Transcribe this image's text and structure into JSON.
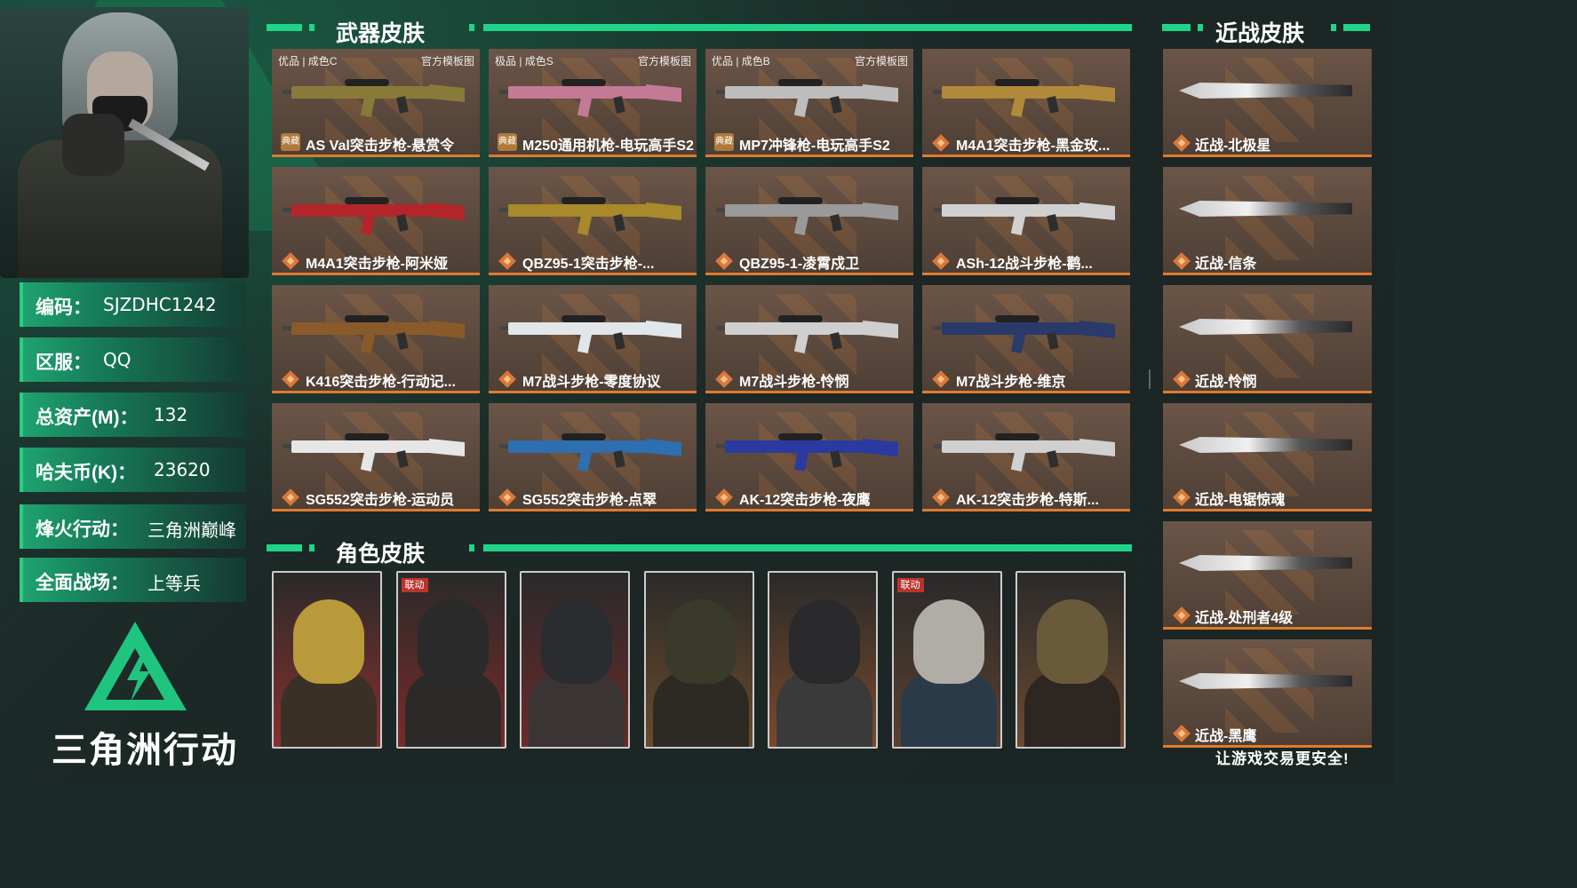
{
  "sections": {
    "weapon_skins": "武器皮肤",
    "melee_skins": "近战皮肤",
    "character_skins": "角色皮肤"
  },
  "profile": {
    "fields": [
      {
        "key": "编码",
        "value": "SJZDHC1242"
      },
      {
        "key": "区服",
        "value": "QQ"
      },
      {
        "key": "总资产(M)",
        "value": "132"
      },
      {
        "key": "哈夫币(K)",
        "value": "23620"
      },
      {
        "key": "烽火行动",
        "value": "三角洲巅峰"
      },
      {
        "key": "全面战场",
        "value": "上等兵"
      }
    ],
    "colon": "："
  },
  "logo": {
    "text": "三角洲行动",
    "icon": "delta-force-logo-icon"
  },
  "slogan": "让游戏交易更安全!",
  "weapons": [
    {
      "name": "AS Val突击步枪-悬赏令",
      "grade": "优品 | 成色C",
      "note": "官方模板图",
      "badge": "典藏",
      "color": "#8a7a3a"
    },
    {
      "name": "M250通用机枪-电玩高手S2",
      "grade": "极品 | 成色S",
      "note": "官方模板图",
      "badge": "典藏",
      "color": "#c47a95"
    },
    {
      "name": "MP7冲锋枪-电玩高手S2",
      "grade": "优品 | 成色B",
      "note": "官方模板图",
      "badge": "典藏",
      "color": "#bdbdbd"
    },
    {
      "name": "M4A1突击步枪-黑金玫...",
      "grade": "",
      "note": "",
      "badge": "",
      "color": "#b08a3a"
    },
    {
      "name": "M4A1突击步枪-阿米娅",
      "grade": "",
      "note": "",
      "badge": "",
      "color": "#b2262a"
    },
    {
      "name": "QBZ95-1突击步枪-...",
      "grade": "",
      "note": "",
      "badge": "",
      "color": "#a8892c"
    },
    {
      "name": "QBZ95-1-凌霄戍卫",
      "grade": "",
      "note": "",
      "badge": "",
      "color": "#9a9a9a"
    },
    {
      "name": "ASh-12战斗步枪-鹳...",
      "grade": "",
      "note": "",
      "badge": "",
      "color": "#d0d0d0"
    },
    {
      "name": "K416突击步枪-行动记...",
      "grade": "",
      "note": "",
      "badge": "",
      "color": "#8a5a2a"
    },
    {
      "name": "M7战斗步枪-零度协议",
      "grade": "",
      "note": "",
      "badge": "",
      "color": "#e0e6ea"
    },
    {
      "name": "M7战斗步枪-怜悯",
      "grade": "",
      "note": "",
      "badge": "",
      "color": "#cfcfcf"
    },
    {
      "name": "M7战斗步枪-维京",
      "grade": "",
      "note": "",
      "badge": "",
      "color": "#2a3a6a"
    },
    {
      "name": "SG552突击步枪-运动员",
      "grade": "",
      "note": "",
      "badge": "",
      "color": "#e6e6e6"
    },
    {
      "name": "SG552突击步枪-点翠",
      "grade": "",
      "note": "",
      "badge": "",
      "color": "#2d6fb0"
    },
    {
      "name": "AK-12突击步枪-夜鹰",
      "grade": "",
      "note": "",
      "badge": "",
      "color": "#2a3aa0"
    },
    {
      "name": "AK-12突击步枪-特斯...",
      "grade": "",
      "note": "",
      "badge": "",
      "color": "#d0d0d0"
    }
  ],
  "melee": [
    {
      "name": "近战-北极星"
    },
    {
      "name": "近战-信条"
    },
    {
      "name": "近战-怜悯"
    },
    {
      "name": "近战-电锯惊魂"
    },
    {
      "name": "近战-处刑者4级"
    },
    {
      "name": "近战-黑鹰"
    }
  ],
  "characters": [
    {
      "collab": "",
      "bg": "#8a2f2f",
      "head": "#b89a3a",
      "body": "#3a3026"
    },
    {
      "collab": "联动",
      "bg": "#7a2a28",
      "head": "#2a2a2a",
      "body": "#2c2a28"
    },
    {
      "collab": "",
      "bg": "#6a2a2a",
      "head": "#2a2c30",
      "body": "#3a3434"
    },
    {
      "collab": "",
      "bg": "#6a4a2c",
      "head": "#3a3a2a",
      "body": "#2c2a22"
    },
    {
      "collab": "",
      "bg": "#7a4a2c",
      "head": "#2a2a2c",
      "body": "#3a3a3a"
    },
    {
      "collab": "联动",
      "bg": "#5a4030",
      "head": "#b0aca6",
      "body": "#2a3a48"
    },
    {
      "collab": "",
      "bg": "#6a4a30",
      "head": "#6a5a3c",
      "body": "#2e2620"
    }
  ]
}
